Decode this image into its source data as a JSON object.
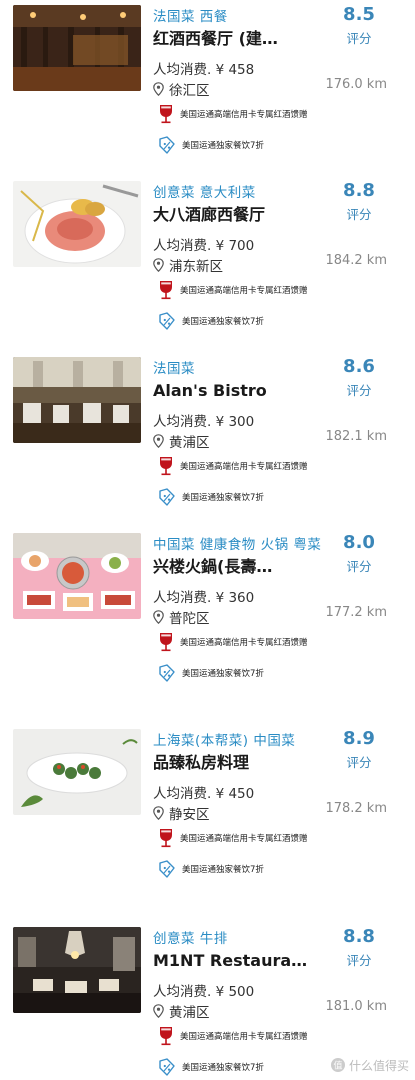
{
  "restaurants": [
    {
      "cuisine": "法国菜  西餐",
      "name": "红酒西餐厅 (建…",
      "price": "人均消费. ¥ 458",
      "district": "徐汇区",
      "distance": "176.0 km",
      "score": "8.5",
      "score_label": "评分",
      "promo_wine": "美国运通高端信用卡专属红酒馈赠",
      "promo_discount": "美国运通独家餐饮7折"
    },
    {
      "cuisine": "创意菜  意大利菜",
      "name": "大八酒廊西餐厅",
      "price": "人均消费. ¥ 700",
      "district": "浦东新区",
      "distance": "184.2 km",
      "score": "8.8",
      "score_label": "评分",
      "promo_wine": "美国运通高端信用卡专属红酒馈赠",
      "promo_discount": "美国运通独家餐饮7折"
    },
    {
      "cuisine": "法国菜",
      "name": "Alan's Bistro",
      "price": "人均消费. ¥ 300",
      "district": "黄浦区",
      "distance": "182.1 km",
      "score": "8.6",
      "score_label": "评分",
      "promo_wine": "美国运通高端信用卡专属红酒馈赠",
      "promo_discount": "美国运通独家餐饮7折"
    },
    {
      "cuisine": "中国菜  健康食物  火锅  粤菜",
      "name": "兴楼火鍋(長壽…",
      "price": "人均消费. ¥ 360",
      "district": "普陀区",
      "distance": "177.2 km",
      "score": "8.0",
      "score_label": "评分",
      "promo_wine": "美国运通高端信用卡专属红酒馈赠",
      "promo_discount": "美国运通独家餐饮7折"
    },
    {
      "cuisine": "上海菜(本帮菜)  中国菜",
      "name": "品臻私房料理",
      "price": "人均消费. ¥ 450",
      "district": "静安区",
      "distance": "178.2 km",
      "score": "8.9",
      "score_label": "评分",
      "promo_wine": "美国运通高端信用卡专属红酒馈赠",
      "promo_discount": "美国运通独家餐饮7折"
    },
    {
      "cuisine": "创意菜  牛排",
      "name": "M1NT Restaura…",
      "price": "人均消费. ¥ 500",
      "district": "黄浦区",
      "distance": "181.0 km",
      "score": "8.8",
      "score_label": "评分",
      "promo_wine": "美国运通高端信用卡专属红酒馈赠",
      "promo_discount": "美国运通独家餐饮7折"
    }
  ],
  "icons": {
    "location": "map-pin-icon",
    "wine": "wine-glass-icon",
    "discount": "discount-tag-icon"
  },
  "colors": {
    "cuisine": "#2a8cc4",
    "score": "#3a86b8",
    "wine_icon": "#c0141c",
    "discount_icon": "#3a8fc9",
    "distance": "#888888"
  },
  "watermark": "什么值得买"
}
